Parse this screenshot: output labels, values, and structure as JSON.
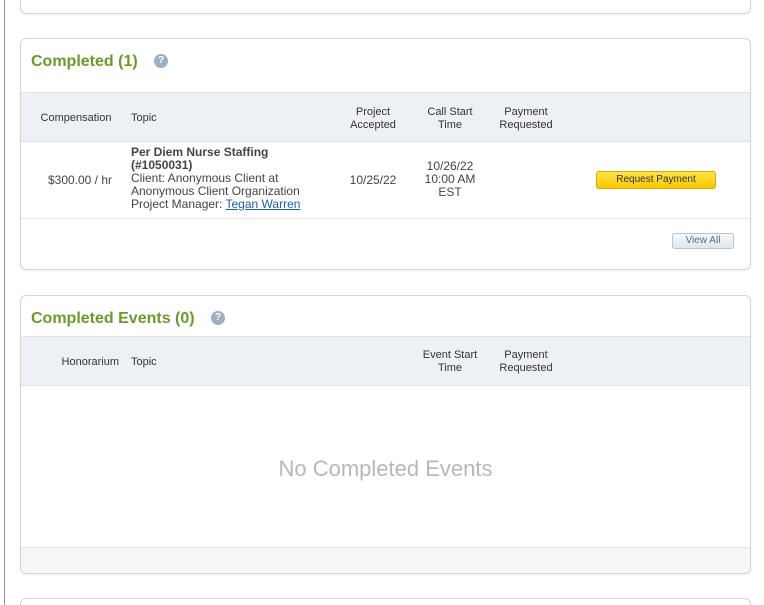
{
  "completed": {
    "title": "Completed (1)",
    "help_icon": "question-mark-icon",
    "columns": {
      "compensation": "Compensation",
      "topic": "Topic",
      "project_accepted": [
        "Project",
        "Accepted"
      ],
      "call_start_time": [
        "Call Start",
        "Time"
      ],
      "payment_requested": [
        "Payment",
        "Requested"
      ]
    },
    "rows": [
      {
        "compensation": "$300.00 / hr",
        "topic_title_line1": "Per Diem Nurse Staffing",
        "topic_title_line2": "(#1050031)",
        "client_line1": "Client: Anonymous Client at",
        "client_line2": "Anonymous Client Organization",
        "pm_label": "Project Manager: ",
        "pm_name": "Tegan Warren",
        "project_accepted": "10/25/22",
        "call_start_time": [
          "10/26/22",
          "10:00 AM",
          "EST"
        ],
        "payment_requested": "",
        "action_label": "Request Payment"
      }
    ],
    "view_all_label": "View All"
  },
  "completed_events": {
    "title": "Completed Events (0)",
    "help_icon": "question-mark-icon",
    "columns": {
      "honorarium": "Honorarium",
      "topic": "Topic",
      "event_start_time": [
        "Event Start",
        "Time"
      ],
      "payment_requested": [
        "Payment",
        "Requested"
      ]
    },
    "empty_message": "No Completed Events"
  },
  "colors": {
    "title_green": "#6a9a2a",
    "link_blue": "#1f5ea8",
    "button_yellow": "#f7c800",
    "header_bg": "#edf1f5"
  }
}
